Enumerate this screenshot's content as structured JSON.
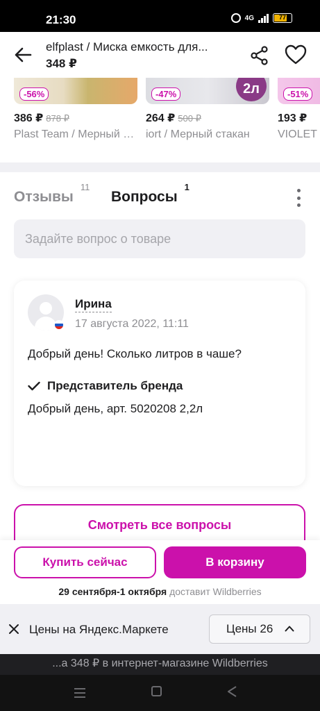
{
  "status_bar": {
    "time": "21:30",
    "network": "4G",
    "battery": "77",
    "battery_level": 0.77
  },
  "header": {
    "title": "elfplast / Миска емкость для...",
    "price": "348 ₽"
  },
  "carousel": [
    {
      "discount": "-56%",
      "price": "386 ₽",
      "old_price": "878 ₽",
      "name": "Plast Team / Мерный кувшин"
    },
    {
      "discount": "-47%",
      "badge": "2л",
      "price": "264 ₽",
      "old_price": "500 ₽",
      "name": "iort / Мерный стакан"
    },
    {
      "discount": "-51%",
      "price": "193 ₽",
      "old_price": "",
      "name": "VIOLET"
    }
  ],
  "qa": {
    "tabs": [
      {
        "label": "Отзывы",
        "count": "11"
      },
      {
        "label": "Вопросы",
        "count": "1"
      }
    ],
    "input_placeholder": "Задайте вопрос о товаре",
    "question": {
      "author": "Ирина",
      "date": "17 августа 2022, 11:11",
      "text": "Добрый день! Сколько литров в чаше?",
      "answer_label": "Представитель бренда",
      "answer_text": "Добрый день, арт. 5020208 2,2л"
    },
    "all_questions_button": "Смотреть все вопросы"
  },
  "buy": {
    "buy_now": "Купить сейчас",
    "to_cart": "В корзину",
    "delivery_dates": "29 сентября-1 октября",
    "delivery_suffix": "доставит Wildberries"
  },
  "market_bar": {
    "text": "Цены на Яндекс.Маркете",
    "button_label": "Цены",
    "button_count": "26"
  },
  "url_bar": {
    "text": "...а 348 ₽ в интернет-магазине Wildberries"
  },
  "colors": {
    "accent": "#cb11ab",
    "muted": "#8e8e92",
    "background": "#f6f6f9"
  },
  "icons": [
    "back-arrow-icon",
    "share-icon",
    "heart-icon",
    "more-vertical-icon",
    "user-icon",
    "flag-icon",
    "check-icon",
    "close-icon",
    "chevron-up-icon"
  ]
}
